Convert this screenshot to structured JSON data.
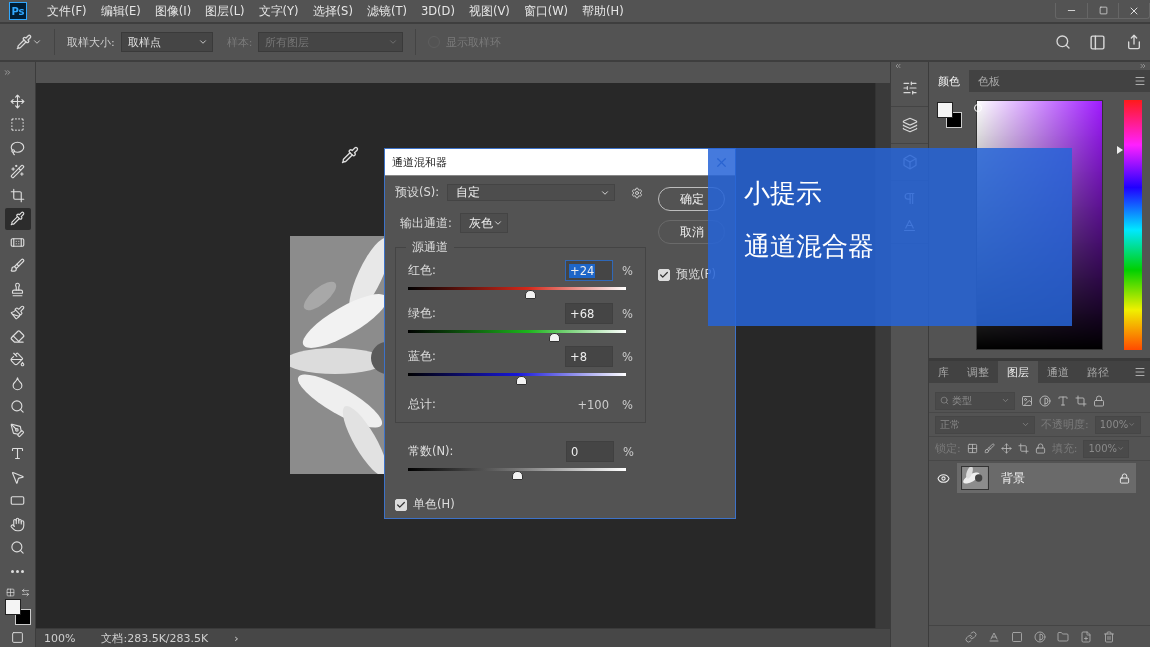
{
  "menu_bar": {
    "app_badge": "Ps",
    "items": [
      "文件(F)",
      "编辑(E)",
      "图像(I)",
      "图层(L)",
      "文字(Y)",
      "选择(S)",
      "滤镜(T)",
      "3D(D)",
      "视图(V)",
      "窗口(W)",
      "帮助(H)"
    ]
  },
  "options_bar": {
    "sample_size_label": "取样大小:",
    "sample_size": "取样点",
    "sample_label": "样本:",
    "sample": "所有图层",
    "show_ring": {
      "label": "显示取样环",
      "checked": false
    }
  },
  "tools": [
    {
      "kind": "move",
      "selected": false
    },
    {
      "kind": "marquee",
      "selected": false
    },
    {
      "kind": "lasso",
      "selected": false
    },
    {
      "kind": "wand",
      "selected": false
    },
    {
      "kind": "crop",
      "selected": false
    },
    {
      "kind": "eyedropper",
      "selected": true
    },
    {
      "kind": "healing",
      "selected": false
    },
    {
      "kind": "brush",
      "selected": false
    },
    {
      "kind": "stamp",
      "selected": false
    },
    {
      "kind": "history",
      "selected": false
    },
    {
      "kind": "eraser",
      "selected": false
    },
    {
      "kind": "bucket",
      "selected": false
    },
    {
      "kind": "blur",
      "selected": false
    },
    {
      "kind": "dodge",
      "selected": false
    },
    {
      "kind": "pen",
      "selected": false
    },
    {
      "kind": "type",
      "selected": false
    },
    {
      "kind": "select",
      "selected": false
    },
    {
      "kind": "rectangle",
      "selected": false
    },
    {
      "kind": "hand",
      "selected": false
    },
    {
      "kind": "zoom",
      "selected": false
    },
    {
      "kind": "more",
      "selected": false
    }
  ],
  "status_bar": {
    "zoom": "100%",
    "document": "文档:283.5K/283.5K",
    "arrow": "›"
  },
  "dialog": {
    "title": "通道混和器",
    "preset_label": "预设(S):",
    "preset": "自定",
    "output_label": "输出通道:",
    "output": "灰色",
    "group_label": "源通道",
    "channels": [
      {
        "kind": "red",
        "label": "红色:",
        "value": "+24",
        "unit": "%",
        "level": 0.56,
        "focused": true
      },
      {
        "kind": "green",
        "label": "绿色:",
        "value": "+68",
        "unit": "%",
        "level": 0.67,
        "focused": false
      },
      {
        "kind": "blue",
        "label": "蓝色:",
        "value": "+8",
        "unit": "%",
        "level": 0.52,
        "focused": false
      }
    ],
    "total": {
      "label": "总计:",
      "value": "+100",
      "unit": "%"
    },
    "constant": {
      "label": "常数(N):",
      "value": "0",
      "unit": "%",
      "level": 0.5
    },
    "monochrome": {
      "label": "单色(H)",
      "checked": true
    },
    "buttons": [
      "确定",
      "取消"
    ],
    "preview": {
      "label": "预览(P)",
      "checked": true
    }
  },
  "color_panel": {
    "tabs": [
      {
        "label": "颜色",
        "selected": true
      },
      {
        "label": "色板",
        "selected": false
      }
    ]
  },
  "layers_panel": {
    "tabs": [
      {
        "label": "库",
        "selected": false
      },
      {
        "label": "调整",
        "selected": false
      },
      {
        "label": "图层",
        "selected": true
      },
      {
        "label": "通道",
        "selected": false
      },
      {
        "label": "路径",
        "selected": false
      }
    ],
    "filter": "类型",
    "blend_mode": "正常",
    "opacity_label": "不透明度:",
    "opacity": "100%",
    "lock_label": "锁定:",
    "fill_label": "填充:",
    "fill": "100%",
    "layers": [
      {
        "name": "背景",
        "visible": true,
        "locked": true,
        "selected": true
      }
    ]
  },
  "tip": {
    "title": "小提示",
    "text": "通道混合器"
  }
}
